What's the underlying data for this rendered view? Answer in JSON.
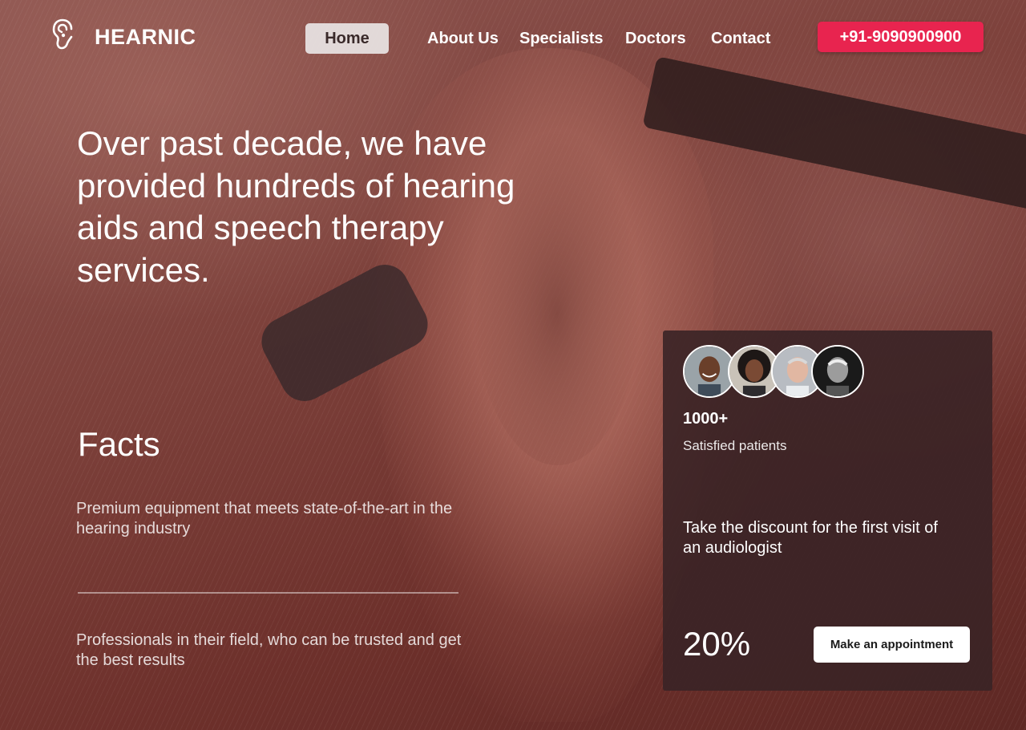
{
  "header": {
    "logo_text": "HEARNIC",
    "logo_icon": "ear-icon",
    "nav": [
      {
        "label": "Home",
        "active": true
      },
      {
        "label": "About Us",
        "active": false
      },
      {
        "label": "Specialists",
        "active": false
      },
      {
        "label": "Doctors",
        "active": false
      },
      {
        "label": "Contact",
        "active": false
      }
    ],
    "phone": "+91-9090900900"
  },
  "hero": {
    "headline": "Over past decade, we have provided hundreds of hearing aids and speech therapy services."
  },
  "facts": {
    "title": "Facts",
    "items": [
      "Premium equipment that meets state-of-the-art in the hearing industry",
      "Professionals in their field, who can be trusted and get the best results"
    ]
  },
  "card": {
    "avatars": [
      "patient-avatar",
      "patient-avatar",
      "patient-avatar",
      "patient-avatar"
    ],
    "stat_count": "1000+",
    "stat_label": "Satisfied patients",
    "discount_text": "Take the discount for the first visit of an audiologist",
    "discount_value": "20%",
    "cta_label": "Make an appointment"
  },
  "colors": {
    "accent": "#e8244f",
    "card_bg": "#3a2426",
    "background_tint": "#7c403a"
  }
}
